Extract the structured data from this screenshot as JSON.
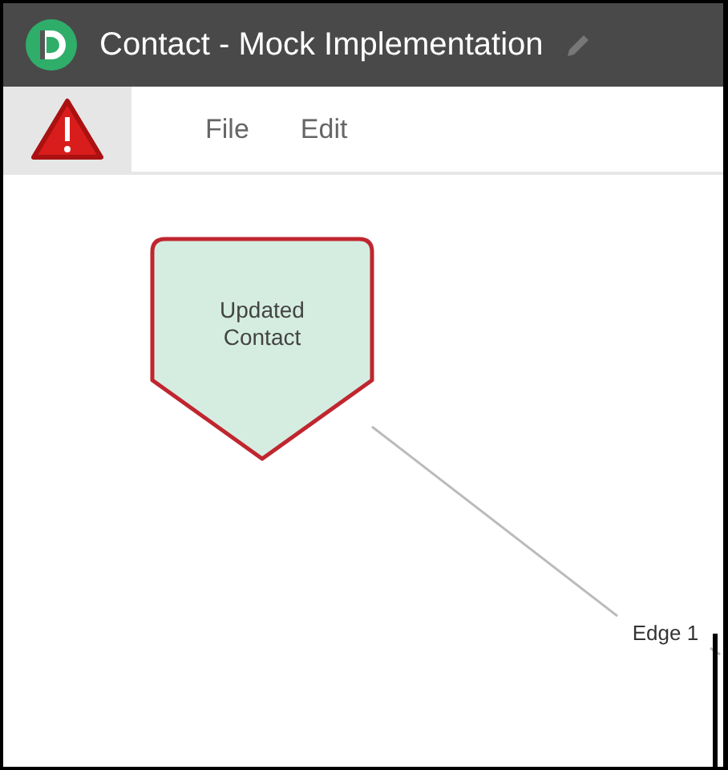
{
  "window": {
    "title": "Contact - Mock Implementation"
  },
  "menu": [
    "File",
    "Edit"
  ],
  "diagram": {
    "nodes": [
      {
        "label": "Updated Contact",
        "kind": "pentagon"
      }
    ],
    "edges": [
      {
        "label": "Edge 1"
      }
    ]
  }
}
